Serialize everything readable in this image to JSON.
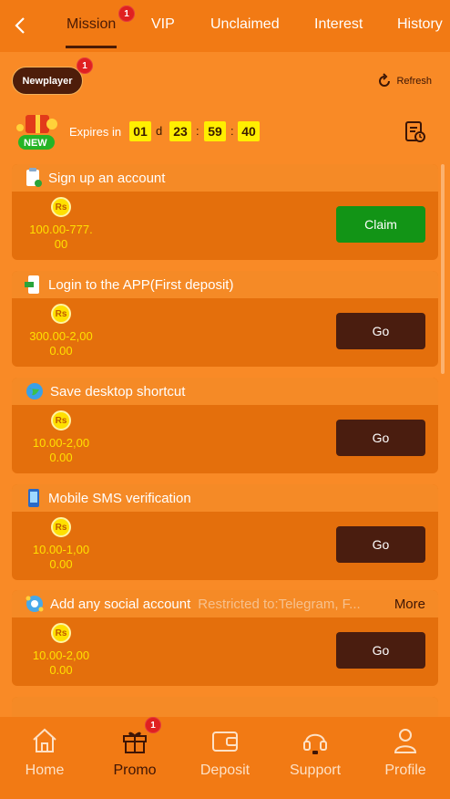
{
  "nav": {
    "tabs": [
      {
        "label": "Mission",
        "badge": "1"
      },
      {
        "label": "VIP"
      },
      {
        "label": "Unclaimed"
      },
      {
        "label": "Interest"
      },
      {
        "label": "History"
      }
    ]
  },
  "filter": {
    "newplayer_label": "Newplayer",
    "newplayer_badge": "1",
    "refresh_label": "Refresh"
  },
  "expires": {
    "label": "Expires in",
    "days": "01",
    "day_unit": "d",
    "hours": "23",
    "minutes": "59",
    "seconds": "40",
    "new_tag": "NEW"
  },
  "currency_symbol": "Rs",
  "missions": [
    {
      "title": "Sign up an account",
      "note": "",
      "more": "",
      "reward_line1": "100.00-777.",
      "reward_line2": "00",
      "button": "Claim",
      "icon": "clipboard-check-icon"
    },
    {
      "title": "Login to the APP(First deposit)",
      "note": "",
      "more": "",
      "reward_line1": "300.00-2,00",
      "reward_line2": "0.00",
      "button": "Go",
      "icon": "phone-login-icon"
    },
    {
      "title": "Save desktop shortcut",
      "note": "",
      "more": "",
      "reward_line1": "10.00-2,00",
      "reward_line2": "0.00",
      "button": "Go",
      "icon": "globe-icon"
    },
    {
      "title": "Mobile SMS verification",
      "note": "",
      "more": "",
      "reward_line1": "10.00-1,00",
      "reward_line2": "0.00",
      "button": "Go",
      "icon": "phone-sms-icon"
    },
    {
      "title": "Add any social account",
      "note": "Restricted to:Telegram, F...",
      "more": "More",
      "reward_line1": "10.00-2,00",
      "reward_line2": "0.00",
      "button": "Go",
      "icon": "social-icon"
    }
  ],
  "bottom_nav": [
    {
      "label": "Home"
    },
    {
      "label": "Promo",
      "badge": "1"
    },
    {
      "label": "Deposit"
    },
    {
      "label": "Support"
    },
    {
      "label": "Profile"
    }
  ],
  "colors": {
    "background": "#f98a26",
    "topbar": "#f27a14",
    "claim": "#129416",
    "go": "#4a1d0f",
    "accent_text": "#ffe000"
  }
}
